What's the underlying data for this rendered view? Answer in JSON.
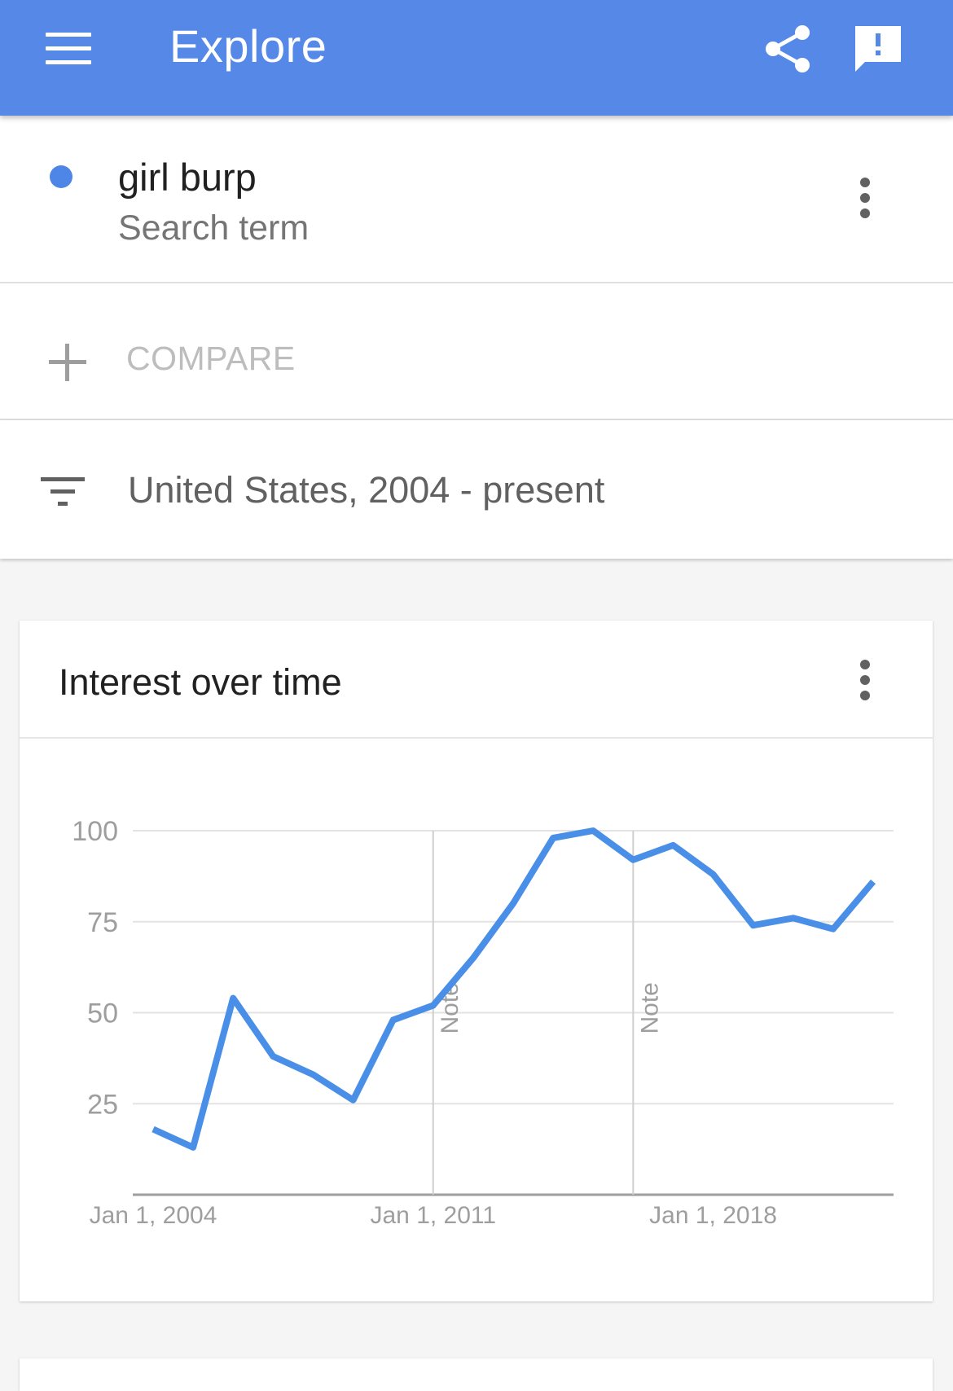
{
  "appbar": {
    "title": "Explore",
    "icons": [
      "menu-icon",
      "share-icon",
      "feedback-icon"
    ],
    "color": "#5588e7"
  },
  "term": {
    "name": "girl burp",
    "type": "Search term",
    "color": "#4e86e8"
  },
  "compare": {
    "label": "COMPARE"
  },
  "filter": {
    "label": "United States, 2004 - present"
  },
  "card": {
    "title": "Interest over time"
  },
  "chart_data": {
    "type": "line",
    "title": "Interest over time",
    "x_ticks": [
      "Jan 1, 2004",
      "Jan 1, 2011",
      "Jan 1, 2018"
    ],
    "y_ticks": [
      25,
      50,
      75,
      100
    ],
    "ylim": [
      0,
      100
    ],
    "grid": true,
    "annotations": [
      {
        "label": "Note",
        "x": "2011"
      },
      {
        "label": "Note",
        "x": "2016"
      }
    ],
    "series": [
      {
        "color": "#4a8fe7",
        "x": [
          2004,
          2005,
          2006,
          2007,
          2008,
          2009,
          2010,
          2011,
          2012,
          2013,
          2014,
          2015,
          2016,
          2017,
          2018,
          2019,
          2020,
          2021,
          2022
        ],
        "values": [
          18,
          13,
          54,
          38,
          33,
          26,
          48,
          52,
          65,
          80,
          98,
          100,
          92,
          96,
          88,
          74,
          76,
          73,
          86
        ]
      }
    ]
  }
}
